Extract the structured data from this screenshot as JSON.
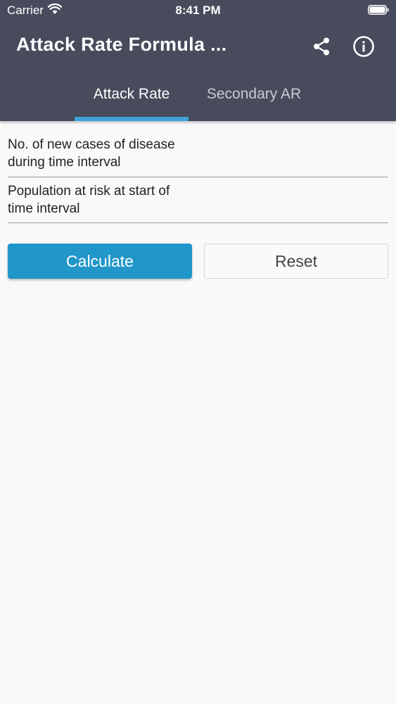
{
  "status_bar": {
    "carrier": "Carrier",
    "time": "8:41 PM"
  },
  "header": {
    "title": "Attack Rate Formula ..."
  },
  "tabs": [
    {
      "label": "Attack Rate",
      "active": true
    },
    {
      "label": "Secondary AR",
      "active": false
    }
  ],
  "form": {
    "fields": [
      {
        "label": "No. of new cases of disease\nduring time interval",
        "value": ""
      },
      {
        "label": "Population at risk at start of\ntime interval",
        "value": ""
      }
    ],
    "calculate_label": "Calculate",
    "reset_label": "Reset"
  },
  "icons": {
    "share": "share-icon",
    "info": "info-icon",
    "wifi": "wifi-icon",
    "battery": "battery-icon"
  },
  "colors": {
    "app_bar": "#474b5c",
    "accent": "#3ea2db",
    "button": "#2196c9",
    "background": "#f9f9f9"
  }
}
